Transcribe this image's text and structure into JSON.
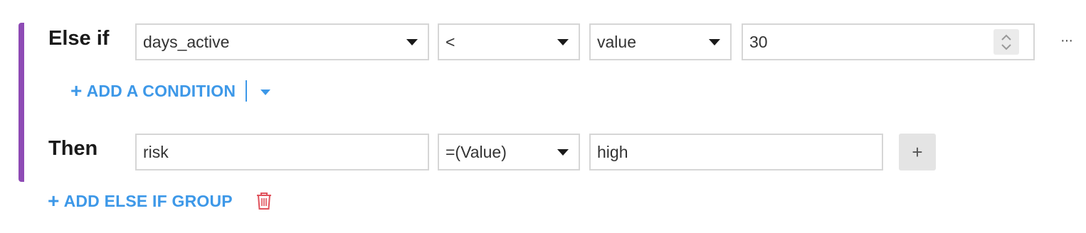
{
  "else_if_group": {
    "label": "Else if",
    "condition": {
      "column": "days_active",
      "operator": "<",
      "value_type": "value",
      "value": "30"
    },
    "add_condition_label": "ADD A CONDITION",
    "more_label": "···"
  },
  "then": {
    "label": "Then",
    "column": "risk",
    "operator": "=(Value)",
    "value": "high",
    "add_label": "+"
  },
  "add_else_if_group_label": "ADD ELSE IF GROUP",
  "colors": {
    "accent": "#3d98e8",
    "group_bar": "#8e4bb5",
    "delete": "#e0525c"
  },
  "icons": {
    "plus": "plus-icon",
    "caret": "chevron-down-icon",
    "spinner": "spinner-icon",
    "delete": "trash-icon",
    "more": "more-icon"
  }
}
